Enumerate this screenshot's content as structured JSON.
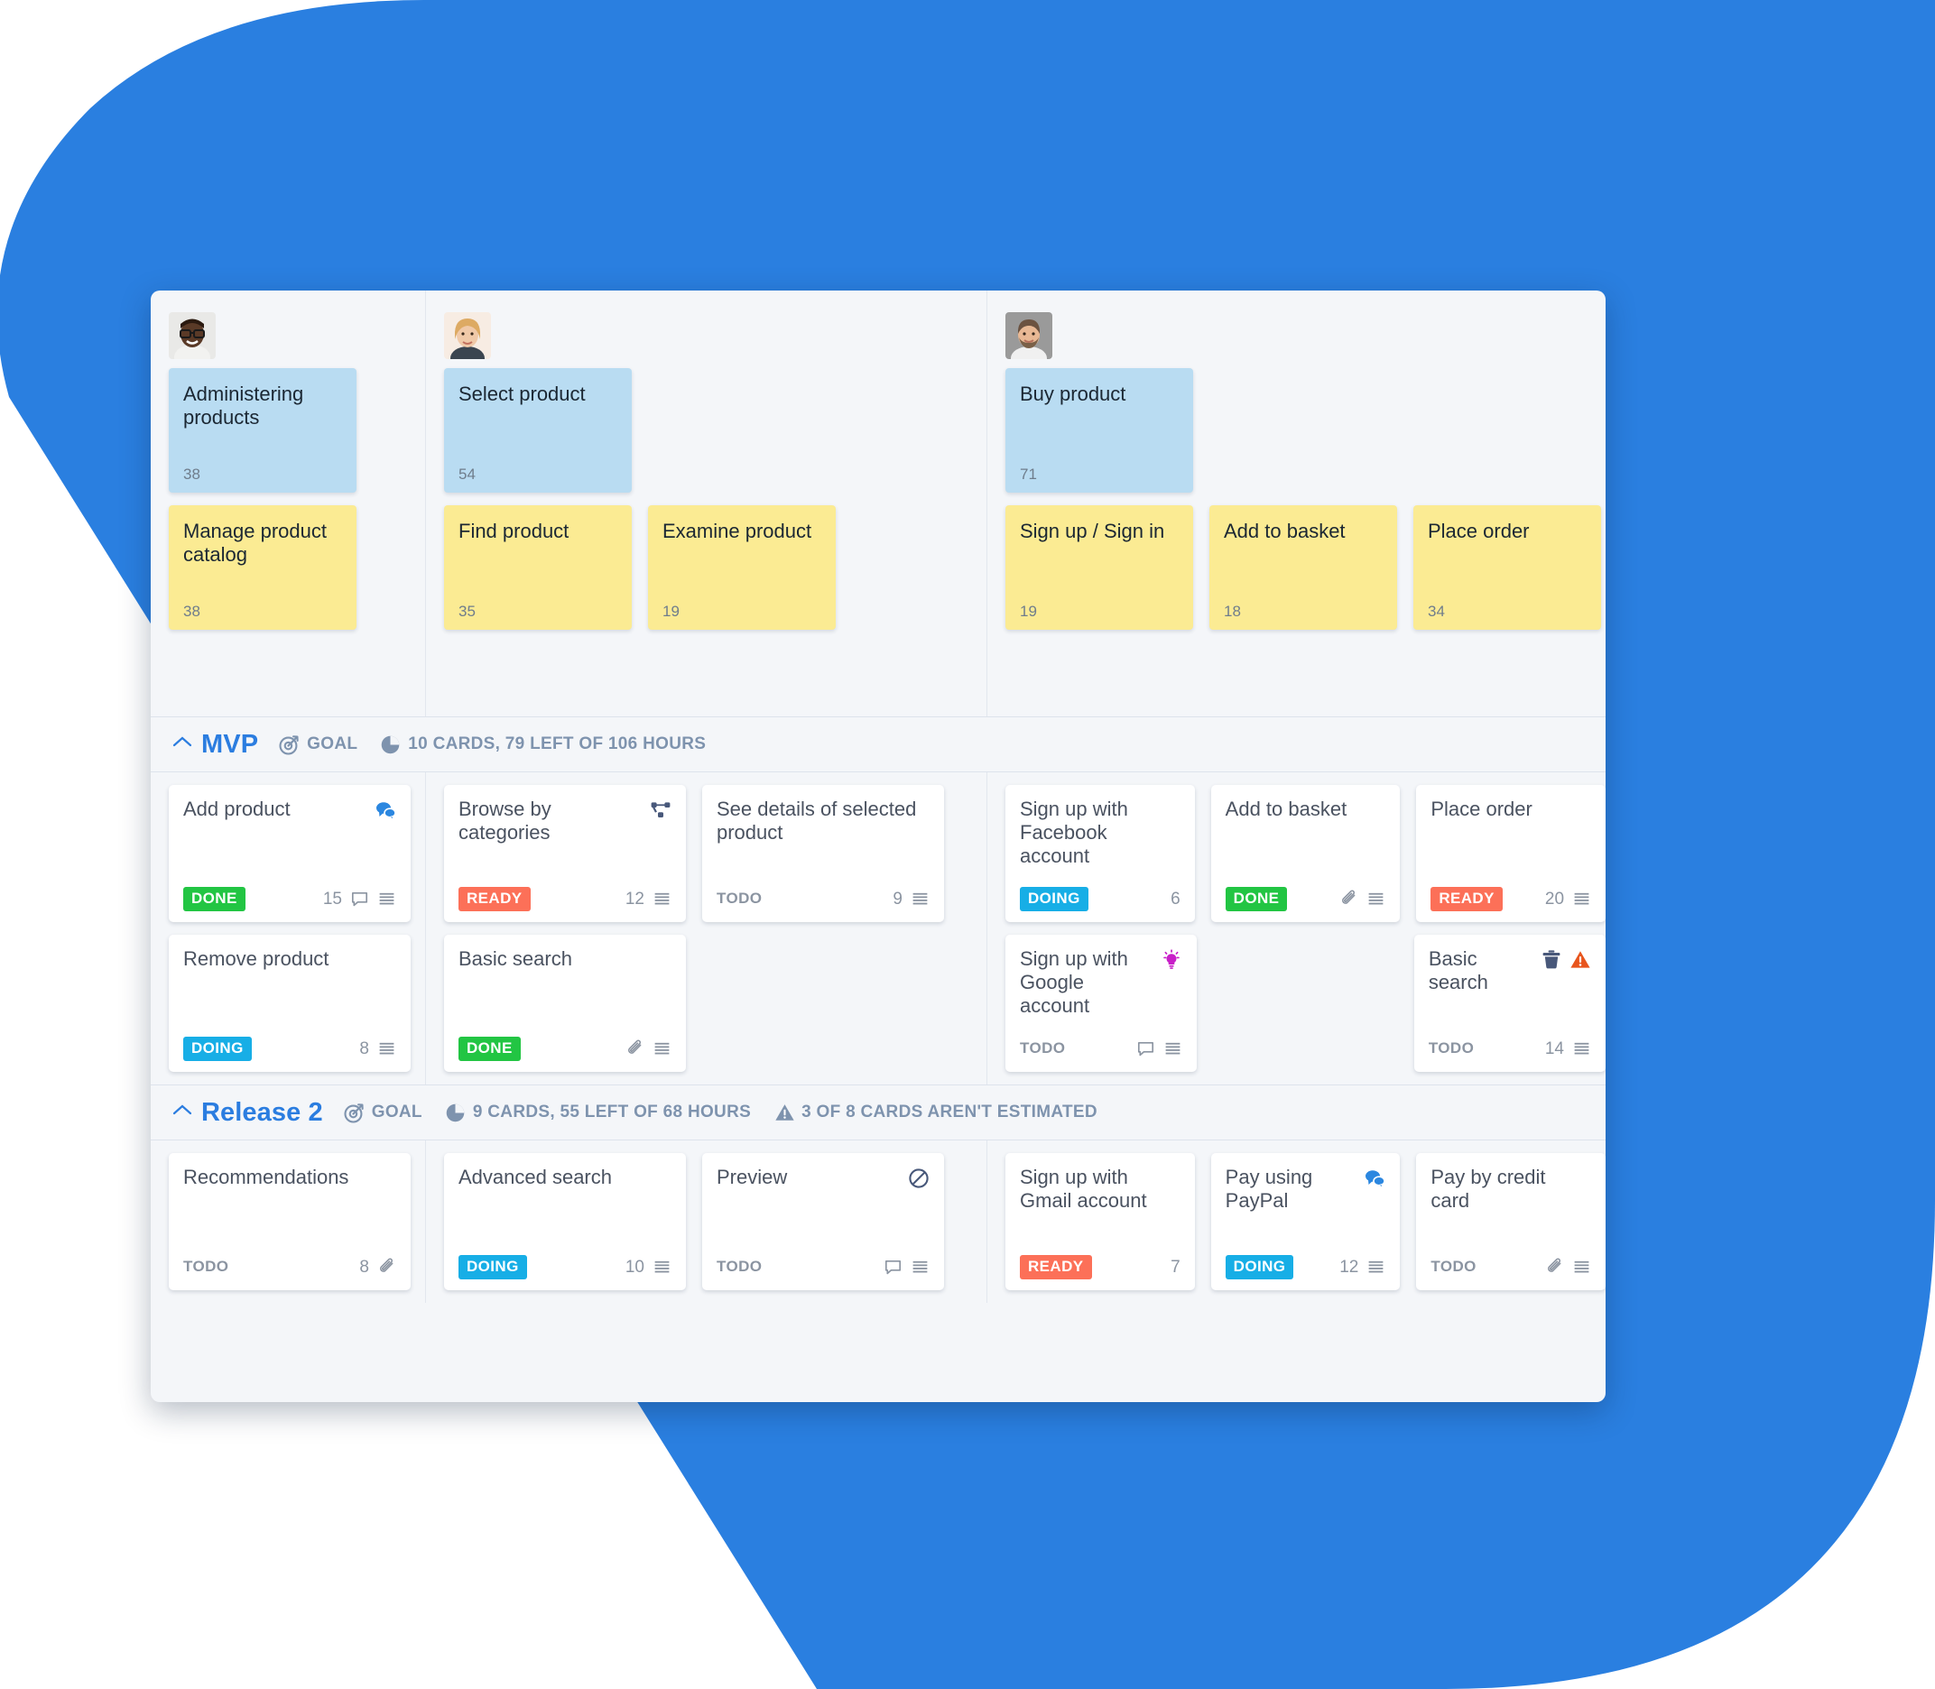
{
  "theme": {
    "brand_blue": "#2b7de0",
    "blob_blue": "#2a7fe0",
    "board_bg": "#f4f6f9",
    "note_blue": "#b9dcf2",
    "note_yellow": "#fbeb93",
    "badge_done": "#22c543",
    "badge_doing": "#17aee6",
    "badge_ready": "#fc7058",
    "badge_todo_text": "#8b94a1",
    "warning_orange": "#e8551d",
    "bulb_magenta": "#c81fc8",
    "icon_slate": "#48587a"
  },
  "activity_columns": [
    {
      "avatar": "avatar-dark-man-glasses",
      "activities": [
        {
          "title": "Administering products",
          "number": "38",
          "color": "blue"
        }
      ],
      "tasks": [
        {
          "title": "Manage product catalog",
          "number": "38",
          "color": "yellow"
        }
      ]
    },
    {
      "avatar": "avatar-blonde-woman",
      "activities": [
        {
          "title": "Select product",
          "number": "54",
          "color": "blue"
        }
      ],
      "tasks": [
        {
          "title": "Find product",
          "number": "35",
          "color": "yellow"
        },
        {
          "title": "Examine product",
          "number": "19",
          "color": "yellow"
        }
      ]
    },
    {
      "avatar": "avatar-bearded-man",
      "activities": [
        {
          "title": "Buy product",
          "number": "71",
          "color": "blue"
        }
      ],
      "tasks": [
        {
          "title": "Sign up / Sign in",
          "number": "19",
          "color": "yellow"
        },
        {
          "title": "Add to basket",
          "number": "18",
          "color": "yellow"
        },
        {
          "title": "Place order",
          "number": "34",
          "color": "yellow"
        }
      ]
    }
  ],
  "releases": [
    {
      "name": "MVP",
      "collapse_icon": "chevron-up-icon",
      "goal_label": "GOAL",
      "goal_icon": "target-icon",
      "progress_icon": "pie-chart-icon",
      "progress_label": "10 CARDS, 79 LEFT OF 106 HOURS",
      "warning_icon": null,
      "warning_label": null,
      "columns": [
        {
          "rows": [
            [
              {
                "title": "Add product",
                "head_icons": [
                  "comments-icon"
                ],
                "status": "DONE",
                "status_type": "done",
                "number": "15",
                "foot_icons": [
                  "comment-outline-icon",
                  "description-icon"
                ]
              }
            ],
            [
              {
                "title": "Remove product",
                "head_icons": [],
                "status": "DOING",
                "status_type": "doing",
                "number": "8",
                "foot_icons": [
                  "description-icon"
                ]
              }
            ]
          ]
        },
        {
          "rows": [
            [
              {
                "title": "Browse by categories",
                "head_icons": [
                  "split-branch-icon"
                ],
                "status": "READY",
                "status_type": "ready",
                "number": "12",
                "foot_icons": [
                  "description-icon"
                ]
              },
              {
                "title": "See details of selected product",
                "head_icons": [],
                "status": "TODO",
                "status_type": "todo",
                "number": "9",
                "foot_icons": [
                  "description-icon"
                ]
              }
            ],
            [
              {
                "title": "Basic search",
                "head_icons": [],
                "status": "DONE",
                "status_type": "done",
                "number": "",
                "foot_icons": [
                  "attachment-icon",
                  "description-icon"
                ]
              },
              null
            ]
          ]
        },
        {
          "rows": [
            [
              {
                "title": "Sign up with Facebook account",
                "head_icons": [],
                "status": "DOING",
                "status_type": "doing",
                "number": "6",
                "foot_icons": []
              },
              {
                "title": "Add to basket",
                "head_icons": [],
                "status": "DONE",
                "status_type": "done",
                "number": "",
                "foot_icons": [
                  "attachment-icon",
                  "description-icon"
                ]
              },
              {
                "title": "Place order",
                "head_icons": [],
                "status": "READY",
                "status_type": "ready",
                "number": "20",
                "foot_icons": [
                  "description-icon"
                ]
              }
            ],
            [
              {
                "title": "Sign up with Google account",
                "head_icons": [
                  "lightbulb-icon"
                ],
                "status": "TODO",
                "status_type": "todo",
                "number": "",
                "foot_icons": [
                  "comment-outline-icon",
                  "description-icon"
                ]
              },
              null,
              {
                "title": "Basic search",
                "head_icons": [
                  "trash-icon",
                  "warning-icon"
                ],
                "status": "TODO",
                "status_type": "todo",
                "number": "14",
                "foot_icons": [
                  "description-icon"
                ]
              }
            ]
          ]
        }
      ]
    },
    {
      "name": "Release 2",
      "collapse_icon": "chevron-up-icon",
      "goal_label": "GOAL",
      "goal_icon": "target-icon",
      "progress_icon": "pie-chart-icon",
      "progress_label": "9 CARDS, 55 LEFT OF 68 HOURS",
      "warning_icon": "warning-triangle-icon",
      "warning_label": "3 OF 8 CARDS AREN'T ESTIMATED",
      "columns": [
        {
          "rows": [
            [
              {
                "title": "Recommendations",
                "head_icons": [],
                "status": "TODO",
                "status_type": "todo",
                "number": "8",
                "foot_icons": [
                  "attachment-icon"
                ]
              }
            ]
          ]
        },
        {
          "rows": [
            [
              {
                "title": "Advanced search",
                "head_icons": [],
                "status": "DOING",
                "status_type": "doing",
                "number": "10",
                "foot_icons": [
                  "description-icon"
                ]
              },
              {
                "title": "Preview",
                "head_icons": [
                  "blocked-icon"
                ],
                "status": "TODO",
                "status_type": "todo",
                "number": "",
                "foot_icons": [
                  "comment-outline-icon",
                  "description-icon"
                ]
              }
            ]
          ]
        },
        {
          "rows": [
            [
              {
                "title": "Sign up with Gmail account",
                "head_icons": [],
                "status": "READY",
                "status_type": "ready",
                "number": "7",
                "foot_icons": []
              },
              {
                "title": "Pay using PayPal",
                "head_icons": [
                  "comments-icon"
                ],
                "status": "DOING",
                "status_type": "doing",
                "number": "12",
                "foot_icons": [
                  "description-icon"
                ]
              },
              {
                "title": "Pay by credit card",
                "head_icons": [],
                "status": "TODO",
                "status_type": "todo",
                "number": "",
                "foot_icons": [
                  "attachment-icon",
                  "description-icon"
                ]
              }
            ]
          ]
        }
      ]
    }
  ]
}
